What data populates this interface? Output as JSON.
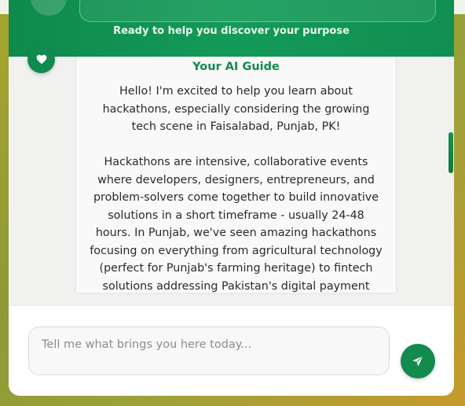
{
  "header": {
    "subtitle": "Ready to help you discover your purpose"
  },
  "message": {
    "author": "Your AI Guide",
    "paragraphs": [
      "Hello! I'm excited to help you learn about hackathons, especially considering the growing tech scene in Faisalabad, Punjab, PK!",
      "Hackathons are intensive, collaborative events where developers, designers, entrepreneurs, and problem-solvers come together to build innovative solutions in a short timeframe - usually 24-48 hours. In Punjab, we've seen amazing hackathons focusing on everything from agricultural technology (perfect for Punjab's farming heritage) to fintech solutions addressing Pakistan's digital payment"
    ]
  },
  "composer": {
    "placeholder": "Tell me what brings you here today..."
  },
  "icons": {
    "avatar": "heart-icon",
    "send": "send-icon"
  },
  "colors": {
    "primary": "#108a4e",
    "title": "#13894e"
  }
}
